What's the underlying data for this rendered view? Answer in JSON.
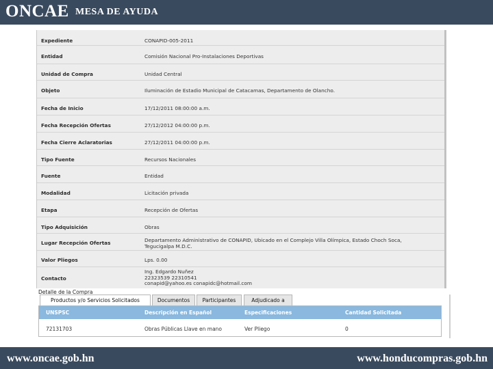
{
  "header": {
    "brand": "ONCAE",
    "subtitle": "MESA DE AYUDA"
  },
  "footer": {
    "left_url": "www.oncae.gob.hn",
    "right_url": "www.honducompras.gob.hn"
  },
  "details": [
    {
      "label": "Expediente",
      "value": "CONAPID-005-2011"
    },
    {
      "label": "Entidad",
      "value": "Comisión Nacional Pro-Instalaciones Deportivas"
    },
    {
      "label": "Unidad de Compra",
      "value": "Unidad Central"
    },
    {
      "label": "Objeto",
      "value": "Iluminación de Estadio Municipal de Catacamas, Departamento de Olancho."
    },
    {
      "label": "Fecha de Inicio",
      "value": "17/12/2011 08:00:00 a.m."
    },
    {
      "label": "Fecha Recepción Ofertas",
      "value": "27/12/2012 04:00:00 p.m."
    },
    {
      "label": "Fecha Cierre Aclaratorias",
      "value": "27/12/2011 04:00:00 p.m."
    },
    {
      "label": "Tipo Fuente",
      "value": "Recursos Nacionales"
    },
    {
      "label": "Fuente",
      "value": "Entidad"
    },
    {
      "label": "Modalidad",
      "value": "Licitación privada"
    },
    {
      "label": "Etapa",
      "value": "Recepción de Ofertas"
    },
    {
      "label": "Tipo Adquisición",
      "value": "Obras"
    },
    {
      "label": "Lugar Recepción Ofertas",
      "value": "Departamento Administrativo de CONAPID, Ubicado en el Complejo Villa Olímpica, Estado Choch Soca,\nTegucigalpa M.D.C."
    },
    {
      "label": "Valor Pliegos",
      "value": "Lps. 0.00"
    },
    {
      "label": "Contacto",
      "value": "Ing. Edgardo Nuñez\n22323539 22310541\nconapid@yahoo.es conapidc@hotmail.com"
    }
  ],
  "section_title": "Detalle de la Compra",
  "tabs": [
    {
      "label": "Productos y/o Servicios Solicitados",
      "active": true
    },
    {
      "label": "Documentos",
      "active": false
    },
    {
      "label": "Participantes",
      "active": false
    },
    {
      "label": "Adjudicado a",
      "active": false
    }
  ],
  "products": {
    "columns": [
      "UNSPSC",
      "Descripción en Español",
      "Especificaciones",
      "Cantidad Solicitada"
    ],
    "rows": [
      [
        "72131703",
        "Obras Públicas Llave en mano",
        "Ver Pliego",
        "0"
      ]
    ]
  },
  "colors": {
    "band": "#3a4a5e",
    "table_header": "#8ab8de",
    "panel": "#ededed"
  }
}
